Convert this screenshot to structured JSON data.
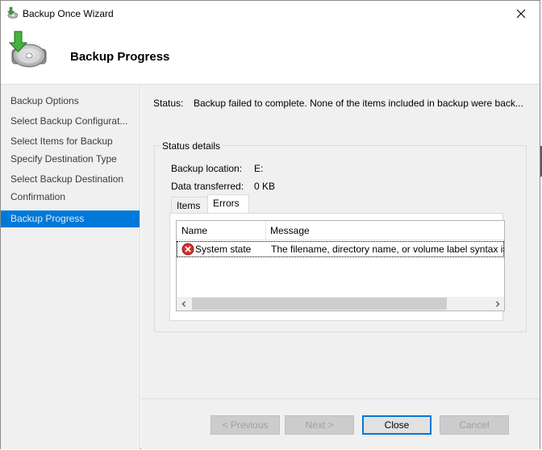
{
  "window": {
    "title": "Backup Once Wizard",
    "header_title": "Backup Progress"
  },
  "nav": {
    "items": [
      {
        "label": "Backup Options",
        "active": false
      },
      {
        "label": "Select Backup Configurat...",
        "active": false
      },
      {
        "label": "Select Items for Backup",
        "active": false
      },
      {
        "label": "Specify Destination Type",
        "active": false
      },
      {
        "label": "Select Backup Destination",
        "active": false
      },
      {
        "label": "Confirmation",
        "active": false
      },
      {
        "label": "Backup Progress",
        "active": true
      }
    ]
  },
  "status": {
    "label": "Status:",
    "value": "Backup failed to complete. None of the items included in backup were back..."
  },
  "details": {
    "legend": "Status details",
    "location_label": "Backup location:",
    "location_value": "E:",
    "transferred_label": "Data transferred:",
    "transferred_value": "0 KB"
  },
  "tabs": [
    {
      "label": "Items",
      "selected": false
    },
    {
      "label": "Errors",
      "selected": true
    }
  ],
  "errors_table": {
    "columns": [
      "Name",
      "Message"
    ],
    "rows": [
      {
        "name": "System state",
        "message": "The filename, directory name, or volume label syntax is incorrect."
      }
    ]
  },
  "buttons": {
    "previous": "< Previous",
    "next": "Next >",
    "close": "Close",
    "cancel": "Cancel"
  },
  "colors": {
    "accent": "#0078d7",
    "error": "#c42b1c"
  },
  "icons": [
    "backup-app-icon",
    "close-icon",
    "backup-disc-icon",
    "error-icon",
    "scroll-left-icon",
    "scroll-right-icon"
  ]
}
